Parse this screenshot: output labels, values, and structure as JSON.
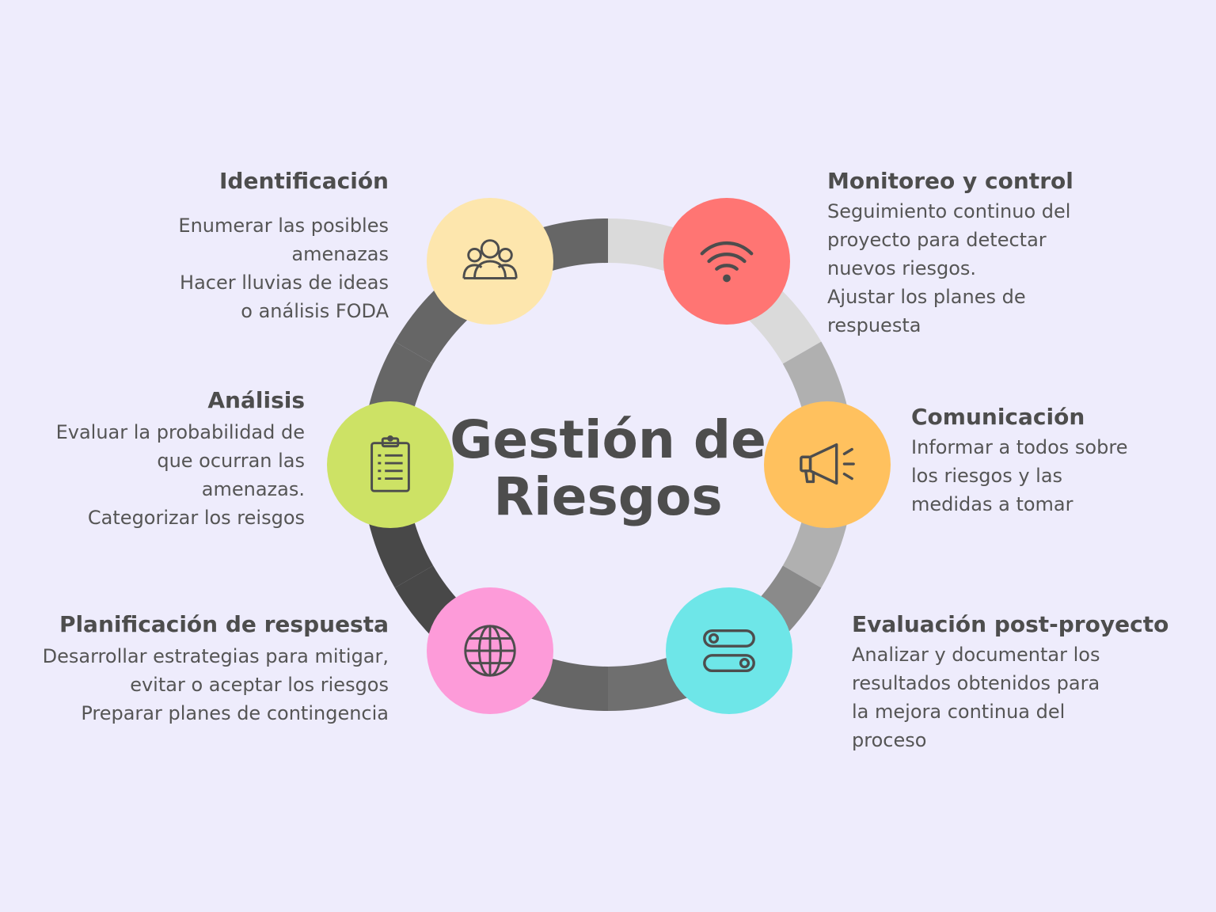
{
  "title_lines": [
    "Gestión de",
    "Riesgos"
  ],
  "ring_colors": {
    "segments": [
      "#dadada",
      "#dadada",
      "#b0b0b0",
      "#b0b0b0",
      "#8a8a8a",
      "#6f6f6f",
      "#666666",
      "#484848",
      "#484848",
      "#666666",
      "#666666",
      "#666666"
    ]
  },
  "steps": [
    {
      "key": "identificacion",
      "title": "Identificación",
      "lines": [
        "Enumerar las posibles",
        "amenazas",
        "Hacer lluvias de ideas",
        "o análisis FODA"
      ],
      "color": "#fde6ad",
      "icon": "users-icon"
    },
    {
      "key": "monitoreo",
      "title": "Monitoreo y control",
      "lines": [
        "Seguimiento continuo del",
        "proyecto para detectar",
        "nuevos riesgos.",
        "Ajustar los planes de",
        "respuesta"
      ],
      "color": "#ff7573",
      "icon": "wifi-icon"
    },
    {
      "key": "analisis",
      "title": "Análisis",
      "lines": [
        "Evaluar la probabilidad de",
        "que ocurran las",
        "amenazas. ",
        "Categorizar los reisgos"
      ],
      "color": "#cde265",
      "icon": "clipboard-icon"
    },
    {
      "key": "comunicacion",
      "title": "Comunicación",
      "lines": [
        "Informar a todos sobre",
        "los riesgos y las",
        "medidas a tomar"
      ],
      "color": "#ffc15e",
      "icon": "megaphone-icon"
    },
    {
      "key": "planificacion",
      "title": "Planificación de respuesta",
      "lines": [
        "Desarrollar estrategias para mitigar,",
        "evitar o aceptar los riesgos",
        "Preparar planes de contingencia"
      ],
      "color": "#fd9bd9",
      "icon": "globe-icon"
    },
    {
      "key": "evaluacion",
      "title": "Evaluación post-proyecto",
      "lines": [
        "Analizar y documentar los",
        "resultados obtenidos para",
        "la mejora continua del",
        "proceso"
      ],
      "color": "#6ee6e8",
      "icon": "toggles-icon"
    }
  ]
}
